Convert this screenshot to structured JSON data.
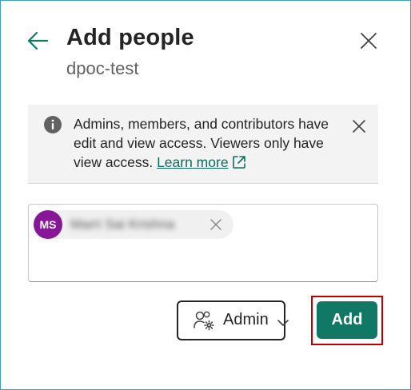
{
  "dialog": {
    "title": "Add people",
    "subtitle": "dpoc-test"
  },
  "banner": {
    "text": "Admins, members, and contributors have edit and view access. Viewers only have view access. ",
    "link_label": "Learn more"
  },
  "people": {
    "chip": {
      "initials": "MS",
      "name": "Marri Sai Krishna"
    }
  },
  "actions": {
    "role_label": "Admin",
    "add_label": "Add"
  },
  "colors": {
    "accent": "#117865",
    "link": "#0f6c5f",
    "avatar": "#881798",
    "highlight": "#c00000"
  },
  "icons": {
    "back": "arrow-left-icon",
    "close": "close-icon",
    "info": "info-icon",
    "external": "open-external-icon",
    "role": "people-settings-icon",
    "chevron": "chevron-down-icon"
  }
}
